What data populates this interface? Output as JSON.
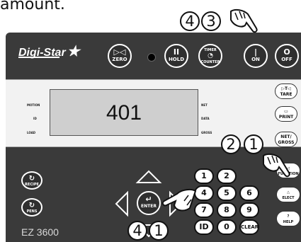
{
  "top_text": "amount.",
  "brand": {
    "name": "Digi-Star"
  },
  "top_buttons": {
    "zero": "ZERO",
    "hold": "HOLD",
    "timer": "TIMER",
    "counter": "COUNTER",
    "on": "ON",
    "off": "OFF"
  },
  "display": {
    "value": "401",
    "labels": {
      "motion": "MOTION",
      "id": "ID",
      "load": "LOAD",
      "net": "NET",
      "data": "DATA",
      "gross": "GROSS"
    }
  },
  "right_buttons": {
    "tare": "TARE",
    "print": "PRINT",
    "net_gross": "NET/ GROSS"
  },
  "left_buttons": {
    "recipe": "RECIPE",
    "pens": "PENS"
  },
  "nav": {
    "enter": "ENTER"
  },
  "keypad": {
    "k1": "1",
    "k2": "2",
    "k4": "4",
    "k5": "5",
    "k6": "6",
    "k7": "7",
    "k8": "8",
    "k9": "9",
    "id": "ID",
    "k0": "0",
    "clear": "CLEAR"
  },
  "function_buttons": {
    "function": "FUNCTION",
    "select": "ELECT",
    "help": "HELP"
  },
  "model": "EZ 3600",
  "steps": {
    "top_a": "4",
    "top_b": "3",
    "mid_a": "2",
    "mid_b": "1",
    "bottom_a": "4",
    "bottom_b": "1"
  },
  "icons": [
    "hand-pointer-icon",
    "zero-icon",
    "hold-icon",
    "timer-icon",
    "power-on-icon",
    "power-off-icon",
    "tare-icon",
    "print-icon",
    "recipe-icon",
    "pens-icon",
    "enter-icon",
    "arrow-up-icon",
    "arrow-down-icon",
    "arrow-left-icon",
    "arrow-right-icon",
    "help-icon"
  ],
  "colors": {
    "panel": "#3a3a3a",
    "display_band": "#f2f2f2",
    "lcd": "#cfcfcf"
  }
}
